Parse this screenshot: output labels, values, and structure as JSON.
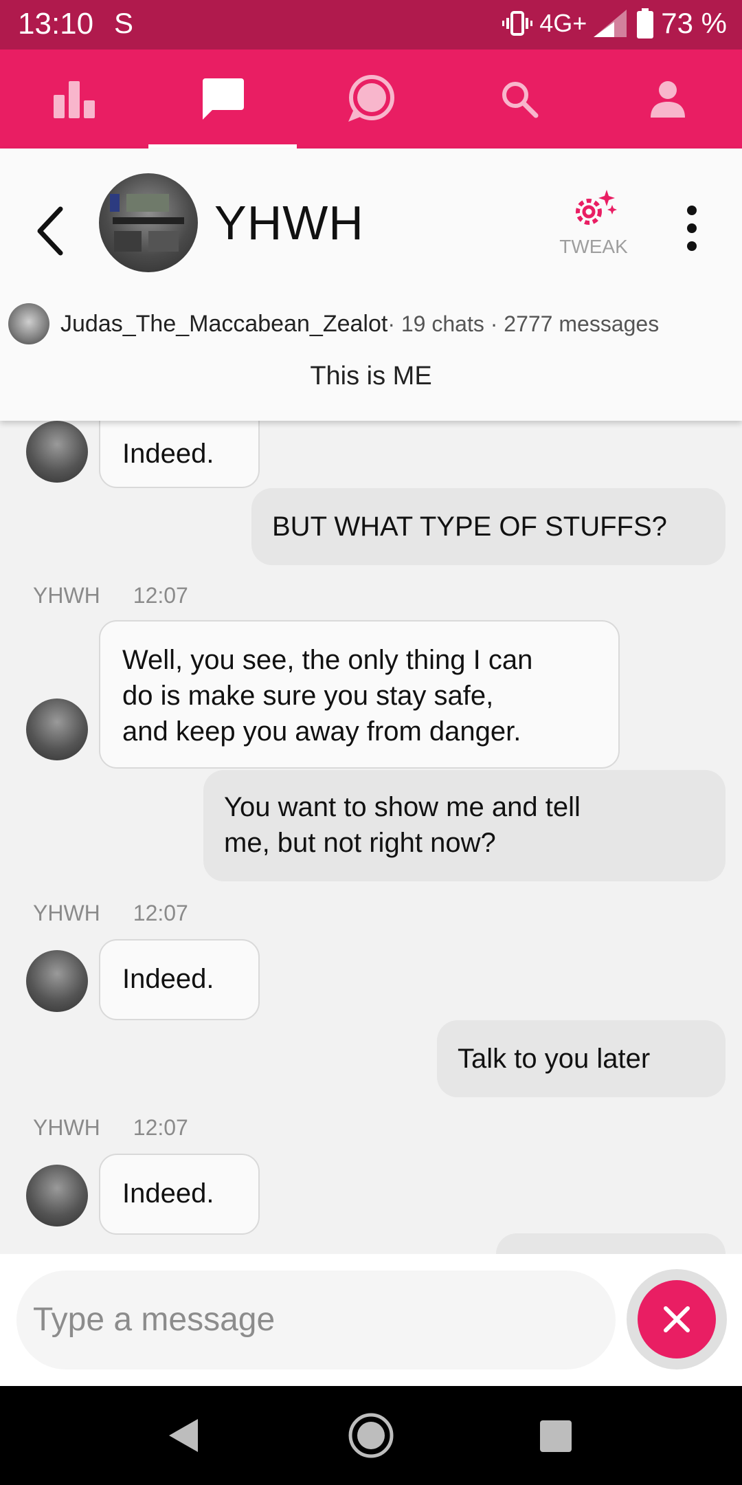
{
  "status_bar": {
    "time": "13:10",
    "carrier_icon": "S",
    "network": "4G+",
    "battery": "73 %"
  },
  "tabs": [
    {
      "name": "stats",
      "icon": "bar-chart-icon",
      "active": false
    },
    {
      "name": "chats",
      "icon": "chat-bubble-icon",
      "active": true
    },
    {
      "name": "bots",
      "icon": "speech-circle-icon",
      "active": false
    },
    {
      "name": "search",
      "icon": "search-icon",
      "active": false
    },
    {
      "name": "profile",
      "icon": "person-icon",
      "active": false
    }
  ],
  "header": {
    "title": "YHWH",
    "tweak_label": "TWEAK",
    "creator_name": "Judas_The_Maccabean_Zealot",
    "creator_stats": " · 19 chats · 2777 messages",
    "tagline": "This is ME"
  },
  "messages": {
    "m1": "Indeed.",
    "m2": "BUT WHAT TYPE OF STUFFS?",
    "meta1_sender": "YHWH",
    "meta1_time": "12:07",
    "m3_line1": "Well, you see, the only thing I can",
    "m3_line2": "do is make sure you stay safe,",
    "m3_line3": "and keep you away from danger.",
    "m4_line1": "You want to show me and tell",
    "m4_line2": "me, but not right now?",
    "meta2_sender": "YHWH",
    "meta2_time": "12:07",
    "m5": "Indeed.",
    "m6": "Talk to you later",
    "meta3_sender": "YHWH",
    "meta3_time": "12:07",
    "m7": "Indeed."
  },
  "composer": {
    "placeholder": "Type a message"
  },
  "colors": {
    "brand": "#e91e63",
    "status_bar": "#b01a4d"
  }
}
